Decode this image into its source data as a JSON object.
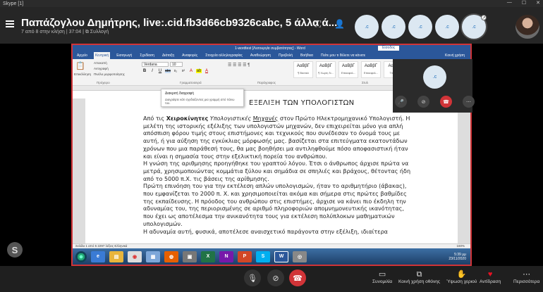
{
  "window": {
    "title": "Skype [1]",
    "controls": [
      "—",
      "☐",
      "✕"
    ]
  },
  "call": {
    "title": "Παπάζογλου Δημήτρης, live:.cid.fb3d66cb9326cabc, 5 άλλα ά...",
    "subtitle": "7 από 8 στην κλήση | 37:04 | ⧉ Συλλογή"
  },
  "participants": [
    {
      "label": ".c"
    },
    {
      "label": ".c"
    },
    {
      "label": ".c"
    },
    {
      "label": ".c"
    },
    {
      "label": ".c"
    },
    {
      "label": ""
    }
  ],
  "word": {
    "title": "1-wordtest [Λειτουργία συμβατότητας] - Word",
    "signin": "Είσοδος",
    "tabs": [
      "Αρχείο",
      "Κεντρική",
      "Εισαγωγή",
      "Σχεδίαση",
      "Διάταξη",
      "Αναφορές",
      "Στοιχεία αλληλογραφίας",
      "Αναθεώρηση",
      "Προβολή",
      "Βοήθεια",
      "Πείτε μου τι θέλετε να κάνετε",
      "Κοινή χρήση"
    ],
    "clipboard": {
      "paste": "Επικόλληση",
      "cut": "Αποκοπή",
      "copy": "Αντιγραφή",
      "painter": "Πινέλο μορφοποίησης",
      "group": "Πρόχειρο"
    },
    "font": {
      "name": "Verdana",
      "size": "10",
      "group": "Γραμματοσειρά"
    },
    "paragraph_group": "Παράγραφος",
    "styles": [
      {
        "preview": "ΑαΒβΓ",
        "name": "¶ Βασικό"
      },
      {
        "preview": "ΑαΒβΓ",
        "name": "¶ Χωρίς δι..."
      },
      {
        "preview": "ΑαΒβΓ",
        "name": "Επικεφαλ..."
      },
      {
        "preview": "ΑαΒβΓ",
        "name": "Επικεφαλ..."
      },
      {
        "preview": "ΑαΒβ",
        "name": "Τίτλος"
      }
    ],
    "styles_group": "Στυλ",
    "tooltip": {
      "title": "Διακριτή διαγραφή",
      "body": "Διαγράψτε κάτι σχεδιάζοντας μια γραμμή από πάνω του."
    },
    "heading": "ΕΞΕΛΙΞΗ ΤΩΝ ΥΠΟΛΟΓΙΣΤΩΝ",
    "p1_a": "Από τις ",
    "p1_bold": "Χειροκίνητες",
    "p1_italic": " Υπολογιστικές ",
    "p1_underline": "Μηχανές",
    "p1_b": " στον Πρώτο Ηλεκτρομηχανικό Υπολογιστή. Η μελέτη της ιστορικής εξέλιξης των υπολογιστών μηχανών, δεν επιχειρείται μόνο για απλή απόσπιση φόρου τιμής στους επιστήμονες και τεχνικούς που συνέδεσαν το όνομά τους με αυτή, ή για αύξηση της εγκύκλιας μόρφωσής μας. βασίζεται στα επιτεύγματα εκατοντάδων χρόνων που μια παράθεσή τους, θα μας βοηθήσει μα αντιληφθούμε πόσο αποφασιστική ήταν και είναι η σημασία τους στην εξελικτική πορεία του ανθρώπου.",
    "p2": "Η γνώση της αριθμησης προηγήθηκε του γραπτού λόγου. Έτσι ο άνθρωπος άρχισε πρώτα να μετρά, χρησιμοποιώντας κομμάτια ξύλου και σημάδια σε σπηλιές και βράχους, θέτοντας ήδη από το 5000 π.Χ. τις βάσεις της αρίθμησης.",
    "p3": "Πρώτη επινόηση του για την εκτέλεση απλών υπολογισμών, ήταν το αριθμητήριο (άβακας), που εμφανίζεται το 2000 π. Χ. και χρησιμοποιείται ακόμα και σήμερα στις πρώτες βαθμίδες της εκπαίδευσης. Η πρόοδος του ανθρώπου στις επιστήμες, άρχισε να κάνει πιο έκδηλη την αδυναμίας του, της περιορισμένης σε αριθμό πληροφοριών απομνημονευτικής ικανότητας, που έχει ως αποτέλεσμα την ανικανότητα τους για εκτέλεση πολύπλοκων μαθηματικών υπολογισμών.",
    "p4": "Η αδυναμία αυτή, φυσικά, αποτέλεσε αναισχετικό παράγοντα στην εξέλιξη, ιδιαίτερα",
    "status": "Σελίδα 1 από 5    2297 λέξεις    Ελληνικά",
    "zoom": "160%",
    "clock_time": "5:39 μμ",
    "clock_date": "23/11/2020"
  },
  "self_view": {
    "label": ".c"
  },
  "controls": {
    "chat": "Συνομιλία",
    "share": "Κοινή χρήση οθόνης",
    "raise": "Ύψωση χεριού",
    "react": "Αντίδραση",
    "more": "Περισσότερα"
  },
  "colors": {
    "end_call": "#d13438",
    "word_blue": "#2b579a",
    "share_border": "#d13438",
    "heart": "#e81123"
  }
}
